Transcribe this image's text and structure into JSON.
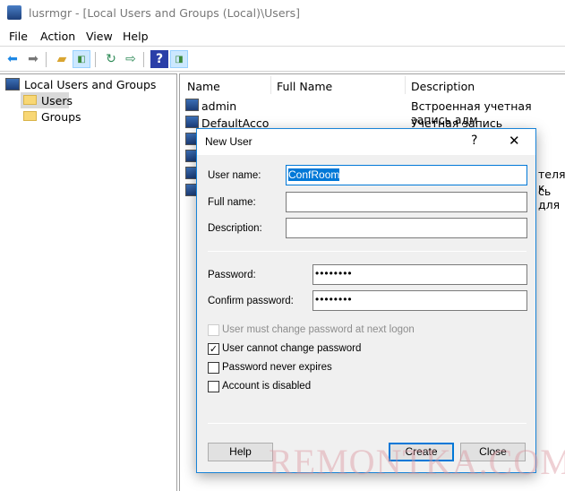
{
  "window": {
    "title": "lusrmgr - [Local Users and Groups (Local)\\Users]"
  },
  "menu": [
    "File",
    "Action",
    "View",
    "Help"
  ],
  "toolbar": {
    "icons": [
      "back-arrow-icon",
      "forward-arrow-icon",
      "up-folder-icon",
      "show-hide-tree-icon",
      "refresh-icon",
      "export-list-icon",
      "help-icon",
      "show-hide-action-pane-icon"
    ]
  },
  "tree": {
    "root": "Local Users and Groups (Local)",
    "items": [
      "Users",
      "Groups"
    ],
    "selected": "Users"
  },
  "list": {
    "columns": [
      "Name",
      "Full Name",
      "Description"
    ],
    "rows": [
      {
        "name": "admin",
        "full": "",
        "desc": "Встроенная учетная запись адм"
      },
      {
        "name": "DefaultAcco",
        "full": "",
        "desc": "Учетная запись пользователя, у"
      },
      {
        "name": "",
        "full": "",
        "desc": ""
      },
      {
        "name": "",
        "full": "",
        "desc": ""
      },
      {
        "name": "",
        "full": "",
        "desc": "теля, к"
      },
      {
        "name": "",
        "full": "",
        "desc": "сь для"
      }
    ]
  },
  "dialog": {
    "title": "New User",
    "help_glyph": "?",
    "close_glyph": "✕",
    "user_name_label": "User name:",
    "user_name_value": "ConfRoom",
    "full_name_label": "Full name:",
    "full_name_value": "",
    "description_label": "Description:",
    "description_value": "",
    "password_label": "Password:",
    "password_value": "••••••••",
    "confirm_label": "Confirm password:",
    "confirm_value": "••••••••",
    "checkboxes": [
      {
        "label": "User must change password at next logon",
        "checked": false,
        "disabled": true
      },
      {
        "label": "User cannot change password",
        "checked": true,
        "disabled": false
      },
      {
        "label": "Password never expires",
        "checked": false,
        "disabled": false
      },
      {
        "label": "Account is disabled",
        "checked": false,
        "disabled": false
      }
    ],
    "help_button": "Help",
    "create_button": "Create",
    "close_button": "Close"
  },
  "watermark": "REMONTKA.COM",
  "colors": {
    "accent": "#0078d7",
    "selection": "#cce8ff"
  }
}
